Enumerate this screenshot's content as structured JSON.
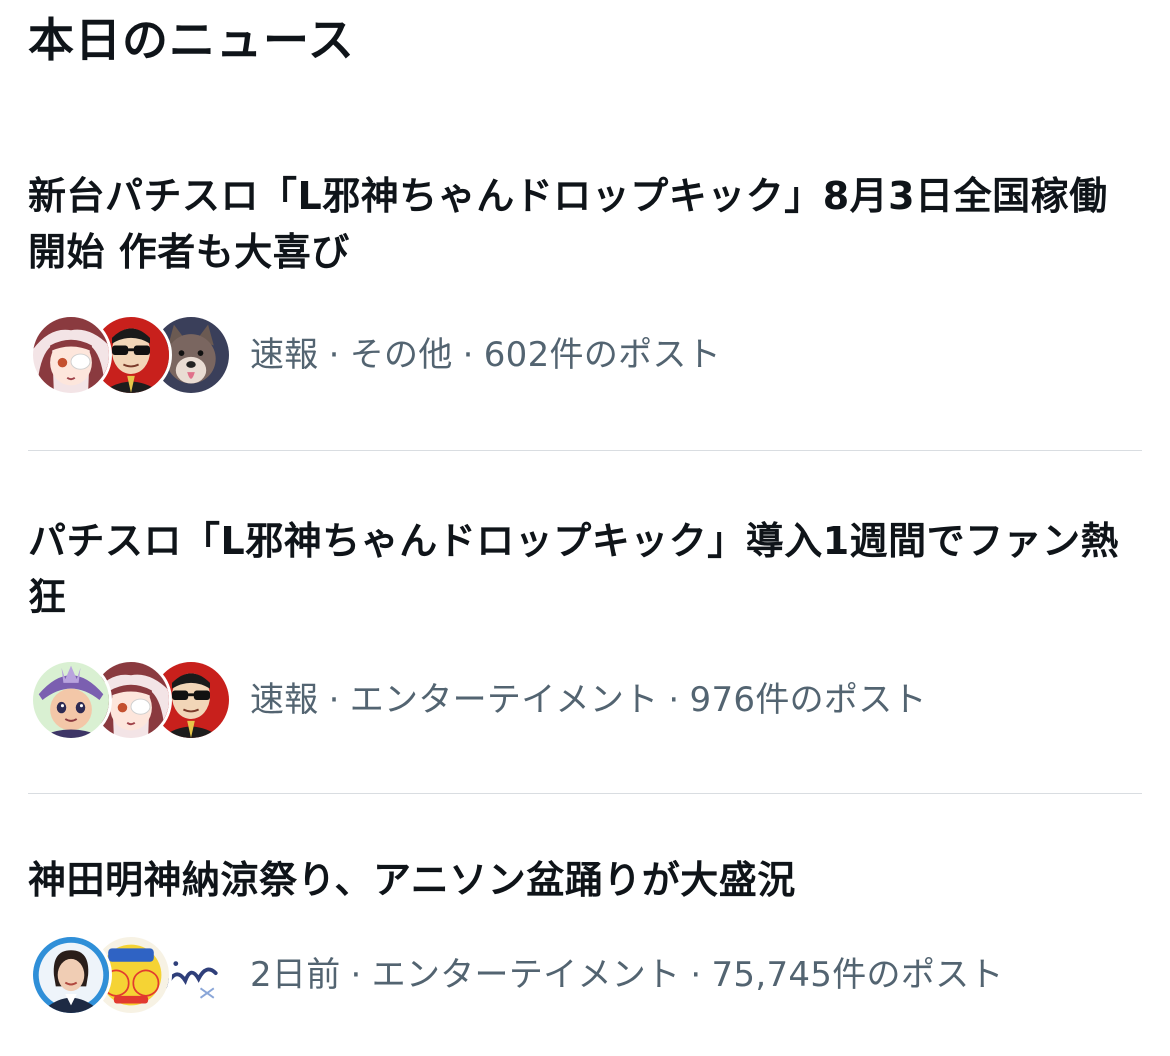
{
  "section": {
    "title": "本日のニュース"
  },
  "news": [
    {
      "headline": "新台パチスロ「L邪神ちゃんドロップキック」8月3日全国稼働開始 作者も大喜び",
      "time": "速報",
      "category": "その他",
      "posts": "602件のポスト",
      "avatars": [
        "anime-girl-eyepatch-avatar",
        "sunglasses-man-avatar",
        "shiba-dog-avatar"
      ]
    },
    {
      "headline": "パチスロ「L邪神ちゃんドロップキック」導入1週間でファン熱狂",
      "time": "速報",
      "category": "エンターテイメント",
      "posts": "976件のポスト",
      "avatars": [
        "anime-character-avatar",
        "anime-girl-eyepatch-avatar",
        "sunglasses-man-avatar"
      ]
    },
    {
      "headline": "神田明神納涼祭り、アニソン盆踊りが大盛況",
      "time": "2日前",
      "category": "エンターテイメント",
      "posts": "75,745件のポスト",
      "avatars": [
        "woman-portrait-avatar",
        "project-logo-avatar",
        "script-logo-avatar"
      ]
    }
  ],
  "colors": {
    "text": "#0f1419",
    "meta": "#536471",
    "divider": "#d9dde1",
    "background": "#ffffff"
  }
}
